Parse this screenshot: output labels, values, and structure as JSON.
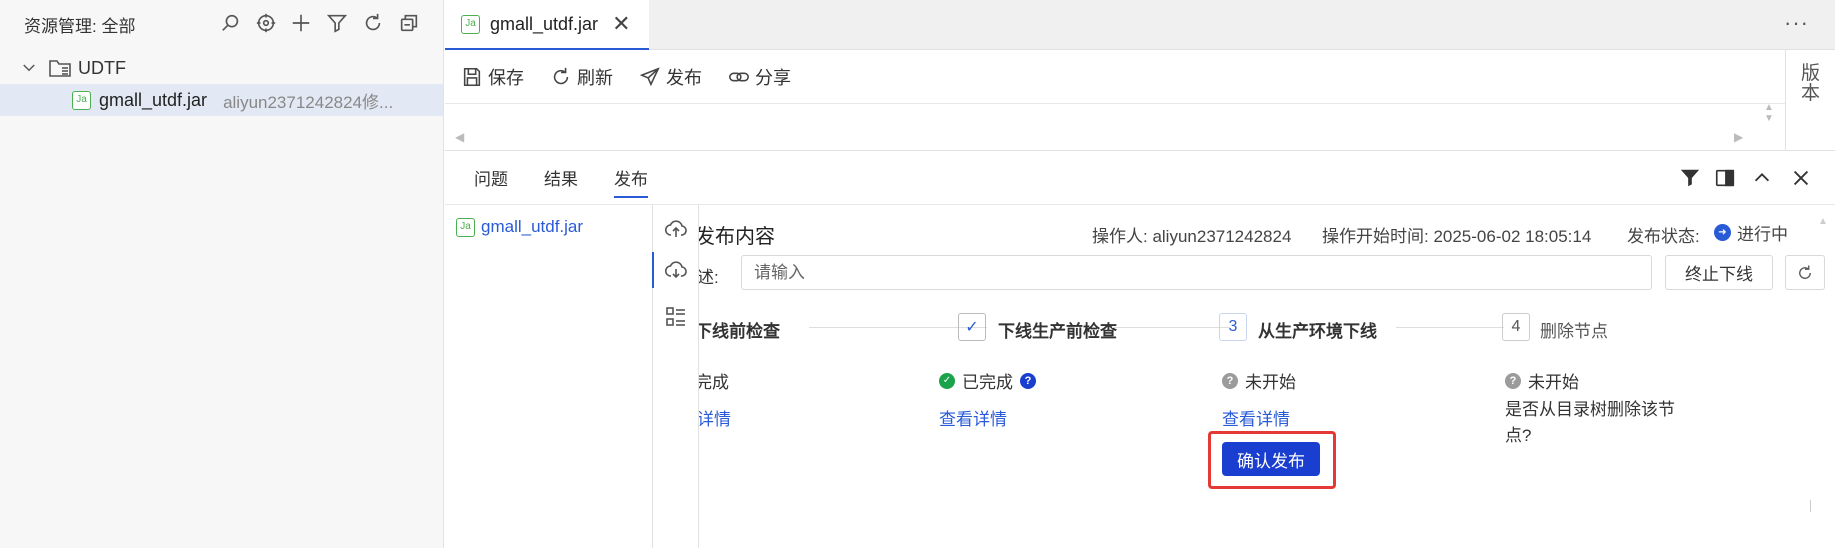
{
  "explorer": {
    "title": "资源管理: 全部",
    "toolbar_icons": [
      "search-icon",
      "locate-icon",
      "add-icon",
      "filter-icon",
      "refresh-icon",
      "collapse-icon"
    ],
    "folder": {
      "name": "UDTF",
      "expanded": true
    },
    "file": {
      "badge": "Ja",
      "name": "gmall_utdf.jar",
      "meta": "aliyun2371242824修..."
    }
  },
  "editor": {
    "tab": {
      "badge": "Ja",
      "label": "gmall_utdf.jar",
      "close": "✕"
    },
    "more": "···",
    "toolbar": {
      "save": "保存",
      "refresh": "刷新",
      "publish": "发布",
      "share": "分享"
    },
    "version_panel": [
      "版",
      "本"
    ]
  },
  "panel": {
    "tabs": [
      "问题",
      "结果",
      "发布"
    ],
    "active_tab": "发布",
    "list_item": {
      "badge": "Ja",
      "name": "gmall_utdf.jar"
    }
  },
  "publish": {
    "title": "发布内容",
    "operator": "操作人: aliyun2371242824",
    "start_time": "操作开始时间: 2025-06-02 18:05:14",
    "status_label": "发布状态:",
    "status_value": "进行中",
    "desc_label": "述:",
    "desc_placeholder": "请输入",
    "stop_button": "终止下线",
    "steps": [
      {
        "title": "下线前检查",
        "status": "完成",
        "link": "详情"
      },
      {
        "marker": "✓",
        "title": "下线生产前检查",
        "status": "已完成",
        "link": "查看详情"
      },
      {
        "marker": "3",
        "title": "从生产环境下线",
        "status": "未开始",
        "link": "查看详情",
        "action": "确认发布"
      },
      {
        "marker": "4",
        "title": "删除节点",
        "status": "未开始",
        "question": "是否从目录树删除该节点?"
      }
    ]
  },
  "colors": {
    "accent": "#2a5bd7",
    "primary_button": "#1a3fd0",
    "highlight": "#e53935",
    "success": "#1aa34a"
  }
}
